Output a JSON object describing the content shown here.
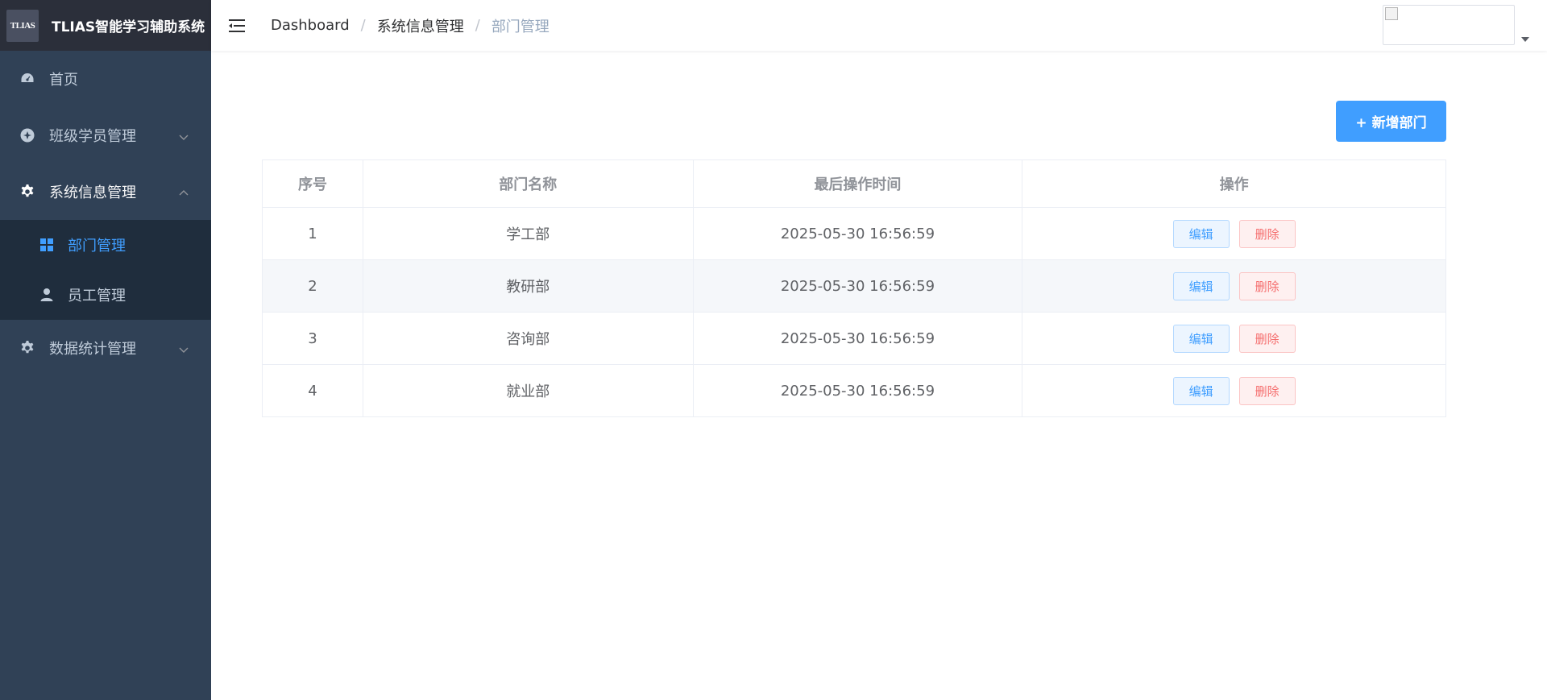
{
  "app": {
    "logo_text": "TLIAS",
    "title": "TLIAS智能学习辅助系统"
  },
  "sidebar": {
    "items": [
      {
        "label": "首页",
        "icon": "dashboard-icon"
      },
      {
        "label": "班级学员管理",
        "icon": "class-icon",
        "expanded": false
      },
      {
        "label": "系统信息管理",
        "icon": "gear-icon",
        "expanded": true,
        "children": [
          {
            "label": "部门管理",
            "icon": "grid-icon",
            "active": true
          },
          {
            "label": "员工管理",
            "icon": "user-icon",
            "active": false
          }
        ]
      },
      {
        "label": "数据统计管理",
        "icon": "gear-icon",
        "expanded": false
      }
    ]
  },
  "header": {
    "breadcrumb": [
      "Dashboard",
      "系统信息管理",
      "部门管理"
    ]
  },
  "toolbar": {
    "add_label": "+ 新增部门"
  },
  "table": {
    "columns": [
      "序号",
      "部门名称",
      "最后操作时间",
      "操作"
    ],
    "rows": [
      {
        "index": "1",
        "name": "学工部",
        "updated": "2025-05-30 16:56:59"
      },
      {
        "index": "2",
        "name": "教研部",
        "updated": "2025-05-30 16:56:59"
      },
      {
        "index": "3",
        "name": "咨询部",
        "updated": "2025-05-30 16:56:59"
      },
      {
        "index": "4",
        "name": "就业部",
        "updated": "2025-05-30 16:56:59"
      }
    ],
    "edit_label": "编辑",
    "delete_label": "删除"
  },
  "colors": {
    "sidebar_bg": "#304156",
    "logo_bg": "#2b2f3a",
    "submenu_bg": "#1f2d3d",
    "primary": "#409eff",
    "danger": "#f56c6c"
  }
}
